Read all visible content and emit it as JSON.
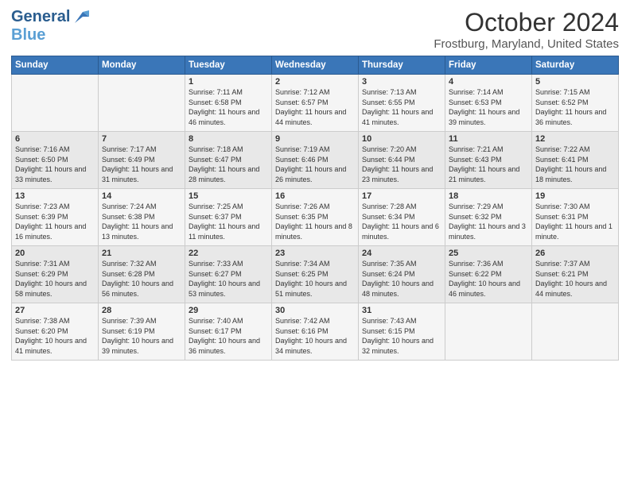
{
  "header": {
    "logo_general": "General",
    "logo_blue": "Blue",
    "month": "October 2024",
    "location": "Frostburg, Maryland, United States"
  },
  "days_of_week": [
    "Sunday",
    "Monday",
    "Tuesday",
    "Wednesday",
    "Thursday",
    "Friday",
    "Saturday"
  ],
  "weeks": [
    [
      {
        "day": "",
        "info": ""
      },
      {
        "day": "",
        "info": ""
      },
      {
        "day": "1",
        "info": "Sunrise: 7:11 AM\nSunset: 6:58 PM\nDaylight: 11 hours and 46 minutes."
      },
      {
        "day": "2",
        "info": "Sunrise: 7:12 AM\nSunset: 6:57 PM\nDaylight: 11 hours and 44 minutes."
      },
      {
        "day": "3",
        "info": "Sunrise: 7:13 AM\nSunset: 6:55 PM\nDaylight: 11 hours and 41 minutes."
      },
      {
        "day": "4",
        "info": "Sunrise: 7:14 AM\nSunset: 6:53 PM\nDaylight: 11 hours and 39 minutes."
      },
      {
        "day": "5",
        "info": "Sunrise: 7:15 AM\nSunset: 6:52 PM\nDaylight: 11 hours and 36 minutes."
      }
    ],
    [
      {
        "day": "6",
        "info": "Sunrise: 7:16 AM\nSunset: 6:50 PM\nDaylight: 11 hours and 33 minutes."
      },
      {
        "day": "7",
        "info": "Sunrise: 7:17 AM\nSunset: 6:49 PM\nDaylight: 11 hours and 31 minutes."
      },
      {
        "day": "8",
        "info": "Sunrise: 7:18 AM\nSunset: 6:47 PM\nDaylight: 11 hours and 28 minutes."
      },
      {
        "day": "9",
        "info": "Sunrise: 7:19 AM\nSunset: 6:46 PM\nDaylight: 11 hours and 26 minutes."
      },
      {
        "day": "10",
        "info": "Sunrise: 7:20 AM\nSunset: 6:44 PM\nDaylight: 11 hours and 23 minutes."
      },
      {
        "day": "11",
        "info": "Sunrise: 7:21 AM\nSunset: 6:43 PM\nDaylight: 11 hours and 21 minutes."
      },
      {
        "day": "12",
        "info": "Sunrise: 7:22 AM\nSunset: 6:41 PM\nDaylight: 11 hours and 18 minutes."
      }
    ],
    [
      {
        "day": "13",
        "info": "Sunrise: 7:23 AM\nSunset: 6:39 PM\nDaylight: 11 hours and 16 minutes."
      },
      {
        "day": "14",
        "info": "Sunrise: 7:24 AM\nSunset: 6:38 PM\nDaylight: 11 hours and 13 minutes."
      },
      {
        "day": "15",
        "info": "Sunrise: 7:25 AM\nSunset: 6:37 PM\nDaylight: 11 hours and 11 minutes."
      },
      {
        "day": "16",
        "info": "Sunrise: 7:26 AM\nSunset: 6:35 PM\nDaylight: 11 hours and 8 minutes."
      },
      {
        "day": "17",
        "info": "Sunrise: 7:28 AM\nSunset: 6:34 PM\nDaylight: 11 hours and 6 minutes."
      },
      {
        "day": "18",
        "info": "Sunrise: 7:29 AM\nSunset: 6:32 PM\nDaylight: 11 hours and 3 minutes."
      },
      {
        "day": "19",
        "info": "Sunrise: 7:30 AM\nSunset: 6:31 PM\nDaylight: 11 hours and 1 minute."
      }
    ],
    [
      {
        "day": "20",
        "info": "Sunrise: 7:31 AM\nSunset: 6:29 PM\nDaylight: 10 hours and 58 minutes."
      },
      {
        "day": "21",
        "info": "Sunrise: 7:32 AM\nSunset: 6:28 PM\nDaylight: 10 hours and 56 minutes."
      },
      {
        "day": "22",
        "info": "Sunrise: 7:33 AM\nSunset: 6:27 PM\nDaylight: 10 hours and 53 minutes."
      },
      {
        "day": "23",
        "info": "Sunrise: 7:34 AM\nSunset: 6:25 PM\nDaylight: 10 hours and 51 minutes."
      },
      {
        "day": "24",
        "info": "Sunrise: 7:35 AM\nSunset: 6:24 PM\nDaylight: 10 hours and 48 minutes."
      },
      {
        "day": "25",
        "info": "Sunrise: 7:36 AM\nSunset: 6:22 PM\nDaylight: 10 hours and 46 minutes."
      },
      {
        "day": "26",
        "info": "Sunrise: 7:37 AM\nSunset: 6:21 PM\nDaylight: 10 hours and 44 minutes."
      }
    ],
    [
      {
        "day": "27",
        "info": "Sunrise: 7:38 AM\nSunset: 6:20 PM\nDaylight: 10 hours and 41 minutes."
      },
      {
        "day": "28",
        "info": "Sunrise: 7:39 AM\nSunset: 6:19 PM\nDaylight: 10 hours and 39 minutes."
      },
      {
        "day": "29",
        "info": "Sunrise: 7:40 AM\nSunset: 6:17 PM\nDaylight: 10 hours and 36 minutes."
      },
      {
        "day": "30",
        "info": "Sunrise: 7:42 AM\nSunset: 6:16 PM\nDaylight: 10 hours and 34 minutes."
      },
      {
        "day": "31",
        "info": "Sunrise: 7:43 AM\nSunset: 6:15 PM\nDaylight: 10 hours and 32 minutes."
      },
      {
        "day": "",
        "info": ""
      },
      {
        "day": "",
        "info": ""
      }
    ]
  ]
}
